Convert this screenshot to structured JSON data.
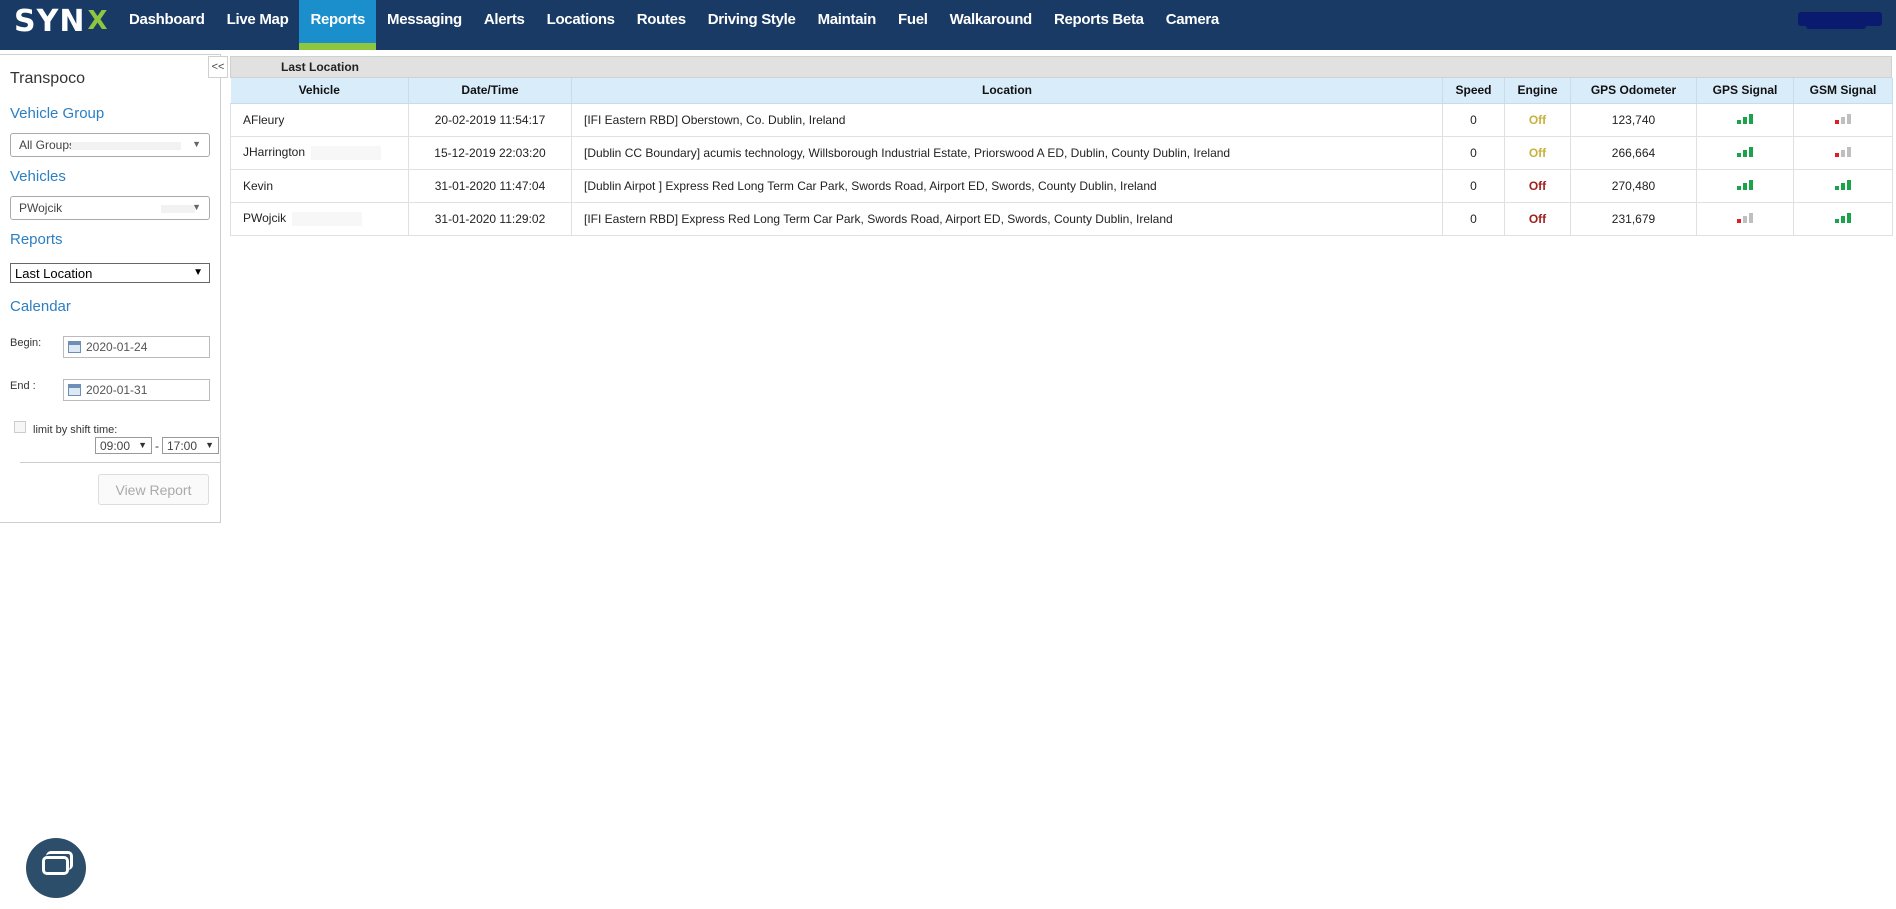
{
  "header": {
    "logo_text": "SYN",
    "logo_accent": "X",
    "nav": [
      {
        "label": "Dashboard",
        "active": false
      },
      {
        "label": "Live Map",
        "active": false
      },
      {
        "label": "Reports",
        "active": true
      },
      {
        "label": "Messaging",
        "active": false
      },
      {
        "label": "Alerts",
        "active": false
      },
      {
        "label": "Locations",
        "active": false
      },
      {
        "label": "Routes",
        "active": false
      },
      {
        "label": "Driving Style",
        "active": false
      },
      {
        "label": "Maintain",
        "active": false
      },
      {
        "label": "Fuel",
        "active": false
      },
      {
        "label": "Walkaround",
        "active": false
      },
      {
        "label": "Reports Beta",
        "active": false
      },
      {
        "label": "Camera",
        "active": false
      }
    ],
    "colors": {
      "bar": "#183a64",
      "active": "#1a8fcc",
      "accent": "#8ec63f"
    }
  },
  "sidebar": {
    "collapse_label": "<<",
    "company": "Transpoco",
    "vehicle_group_label": "Vehicle Group",
    "vehicle_group_value": "All Groups",
    "vehicles_label": "Vehicles",
    "vehicles_value": "PWojcik",
    "reports_label": "Reports",
    "reports_value": "Last Location",
    "calendar_label": "Calendar",
    "begin_label": "Begin:",
    "begin_value": "2020-01-24",
    "end_label": "End :",
    "end_value": "2020-01-31",
    "shift_label": "limit by shift time:",
    "shift_start": "09:00",
    "shift_dash": "-",
    "shift_end": "17:00",
    "view_button": "View Report"
  },
  "report": {
    "title": "Last Location",
    "columns": [
      "Vehicle",
      "Date/Time",
      "Location",
      "Speed",
      "Engine",
      "GPS Odometer",
      "GPS Signal",
      "GSM Signal"
    ],
    "rows": [
      {
        "vehicle": "AFleury",
        "datetime": "20-02-2019 11:54:17",
        "location": "[IFI Eastern RBD] Oberstown, Co. Dublin, Ireland",
        "speed": "0",
        "engine": "Off",
        "engine_color": "yellow",
        "odometer": "123,740",
        "gps_signal": 3,
        "gsm_signal": 1
      },
      {
        "vehicle": "JHarrington",
        "datetime": "15-12-2019 22:03:20",
        "location": "[Dublin CC Boundary] acumis technology, Willsborough Industrial Estate, Priorswood A ED, Dublin, County Dublin, Ireland",
        "speed": "0",
        "engine": "Off",
        "engine_color": "yellow",
        "odometer": "266,664",
        "gps_signal": 3,
        "gsm_signal": 1
      },
      {
        "vehicle": "Kevin",
        "datetime": "31-01-2020 11:47:04",
        "location": "[Dublin Airpot ] Express Red Long Term Car Park, Swords Road, Airport ED, Swords, County Dublin, Ireland",
        "speed": "0",
        "engine": "Off",
        "engine_color": "red",
        "odometer": "270,480",
        "gps_signal": 3,
        "gsm_signal": 3
      },
      {
        "vehicle": "PWojcik",
        "datetime": "31-01-2020 11:29:02",
        "location": "[IFI Eastern RBD] Express Red Long Term Car Park, Swords Road, Airport ED, Swords, County Dublin, Ireland",
        "speed": "0",
        "engine": "Off",
        "engine_color": "red",
        "odometer": "231,679",
        "gps_signal": 1,
        "gsm_signal": 3
      }
    ]
  },
  "icons": {
    "chat": "chat-bubble-icon",
    "calendar": "calendar-icon"
  }
}
